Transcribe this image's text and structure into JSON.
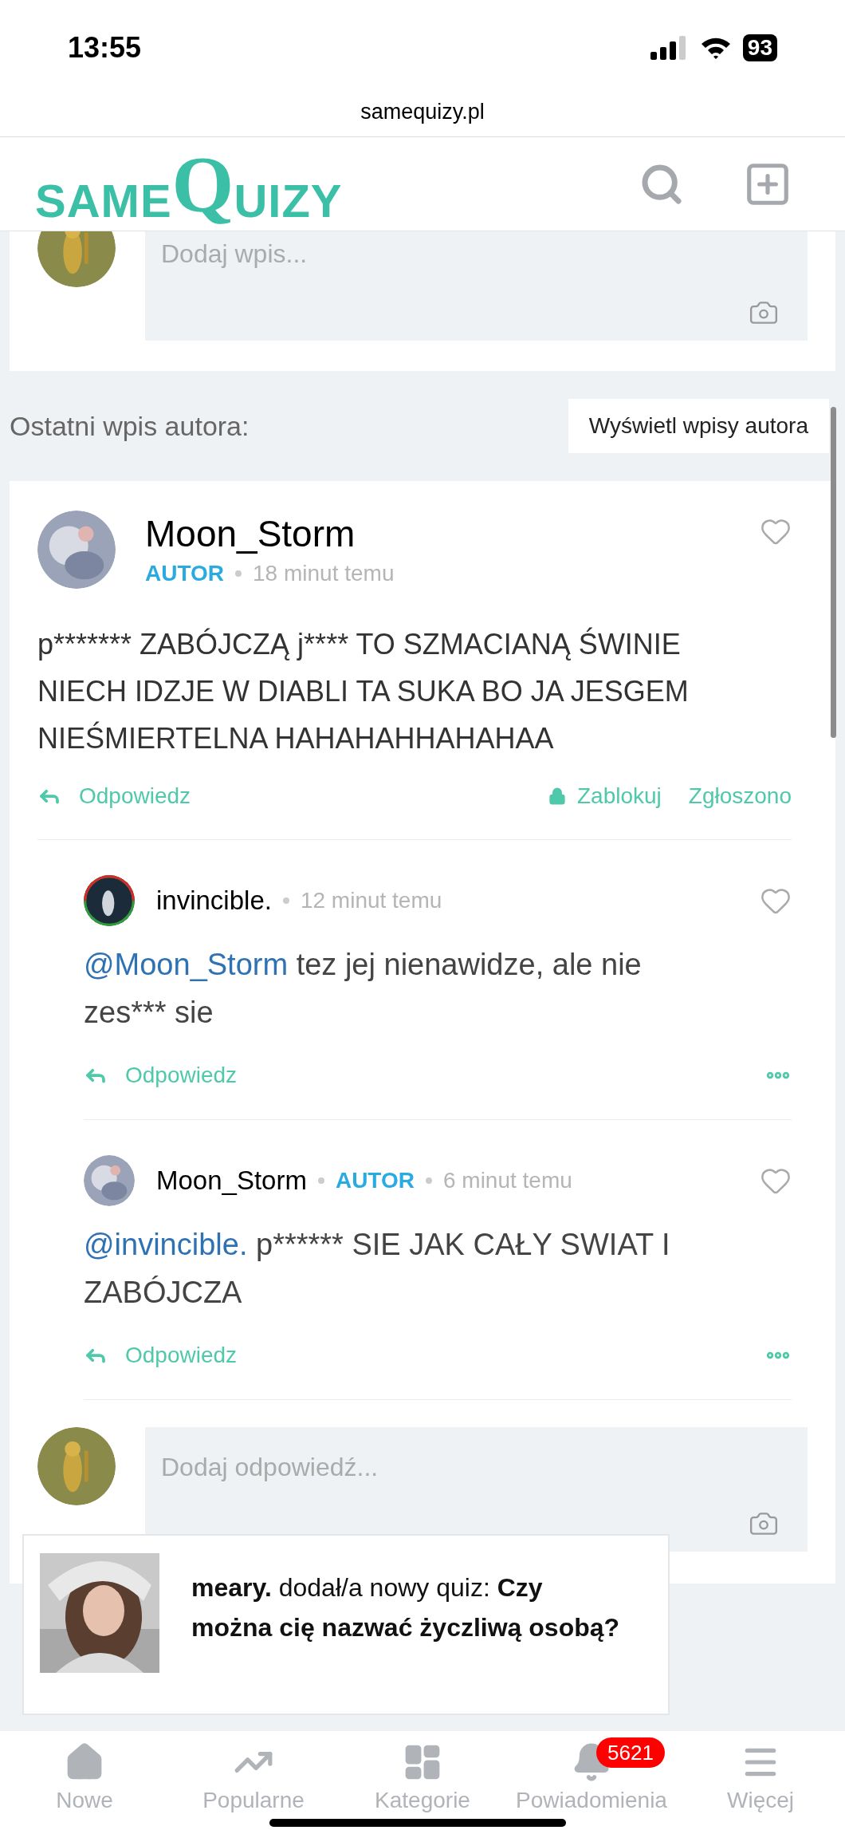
{
  "status_bar": {
    "time": "13:55",
    "battery": "93"
  },
  "address_bar": {
    "url": "samequizy.pl"
  },
  "header": {
    "logo": [
      "SAME",
      "Q",
      "UIZY"
    ]
  },
  "new_post": {
    "placeholder": "Dodaj wpis..."
  },
  "section": {
    "title": "Ostatni wpis autora:",
    "button": "Wyświetl wpisy autora"
  },
  "post": {
    "author": "Moon_Storm",
    "badge": "AUTOR",
    "time": "18 minut temu",
    "text": "p******* ZABÓJCZĄ j**** TO SZMACIANĄ ŚWINIE NIECH IDZJE W DIABLI TA SUKA BO JA JESGEM NIEŚMIERTELNA HAHAHAHHAHAHAA",
    "reply": "Odpowiedz",
    "block": "Zablokuj",
    "report": "Zgłoszono"
  },
  "replies": [
    {
      "author": "invincible.",
      "time": "12 minut temu",
      "mention": "@Moon_Storm",
      "text": " tez jej nienawidze, ale nie zes*** sie",
      "reply": "Odpowiedz"
    },
    {
      "author": "Moon_Storm",
      "badge": "AUTOR",
      "time": "6 minut temu",
      "mention": "@invincible.",
      "text": " p****** SIE JAK CAŁY SWIAT I ZABÓJCZA",
      "reply": "Odpowiedz"
    }
  ],
  "reply_box": {
    "placeholder": "Dodaj odpowiedź..."
  },
  "toast": {
    "text": "**meary.** dodał/a nowy quiz: **Czy można cię nazwać życzliwą osobą?**"
  },
  "bottom_nav": [
    {
      "label": "Nowe",
      "kind": "home"
    },
    {
      "label": "Popularne",
      "kind": "trend"
    },
    {
      "label": "Kategorie",
      "kind": "grid"
    },
    {
      "label": "Powiadomienia",
      "kind": "bell",
      "badge": "5621"
    },
    {
      "label": "Więcej",
      "kind": "menu"
    }
  ]
}
